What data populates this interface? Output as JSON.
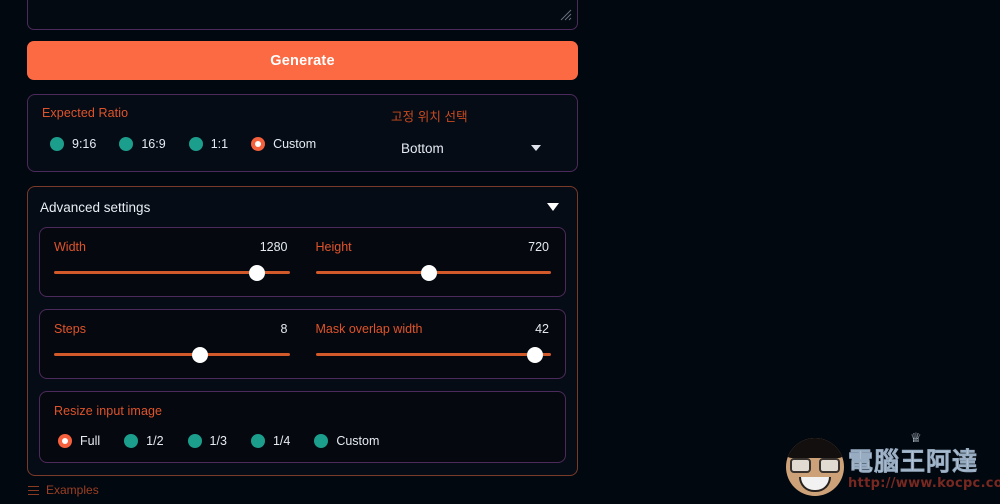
{
  "theme": {
    "background": "#020810",
    "panel_border": "#4d2a5c",
    "accent_orange": "#fc6a43",
    "label_orange": "#e0532a",
    "radio_teal": "#1c9e8d",
    "radio_selected": "#f5603d",
    "slider_track": "#d1592a",
    "text": "#e6eaf2"
  },
  "prompt": {
    "value": "",
    "placeholder": "",
    "resize_handle": "resize-grip"
  },
  "generate": {
    "label": "Generate"
  },
  "ratio_panel": {
    "label": "Expected Ratio",
    "options": [
      {
        "label": "9:16",
        "selected": false
      },
      {
        "label": "16:9",
        "selected": false
      },
      {
        "label": "1:1",
        "selected": false
      },
      {
        "label": "Custom",
        "selected": true
      }
    ],
    "position_select": {
      "label": "고정 위치 선택",
      "value": "Bottom"
    }
  },
  "advanced": {
    "title": "Advanced settings",
    "expanded": true,
    "sliders": [
      {
        "name": "Width",
        "value": "1280",
        "percent": 86
      },
      {
        "name": "Height",
        "value": "720",
        "percent": 48
      },
      {
        "name": "Steps",
        "value": "8",
        "percent": 62
      },
      {
        "name": "Mask overlap width",
        "value": "42",
        "percent": 93
      }
    ],
    "resize_input": {
      "label": "Resize input image",
      "options": [
        {
          "label": "Full",
          "selected": true
        },
        {
          "label": "1/2",
          "selected": false
        },
        {
          "label": "1/3",
          "selected": false
        },
        {
          "label": "1/4",
          "selected": false
        },
        {
          "label": "Custom",
          "selected": false
        }
      ]
    }
  },
  "footer": {
    "examples_label": "Examples"
  },
  "watermark": {
    "title": "電腦王阿達",
    "url": "http://www.kocpc.com.tw",
    "crown": "♕"
  }
}
